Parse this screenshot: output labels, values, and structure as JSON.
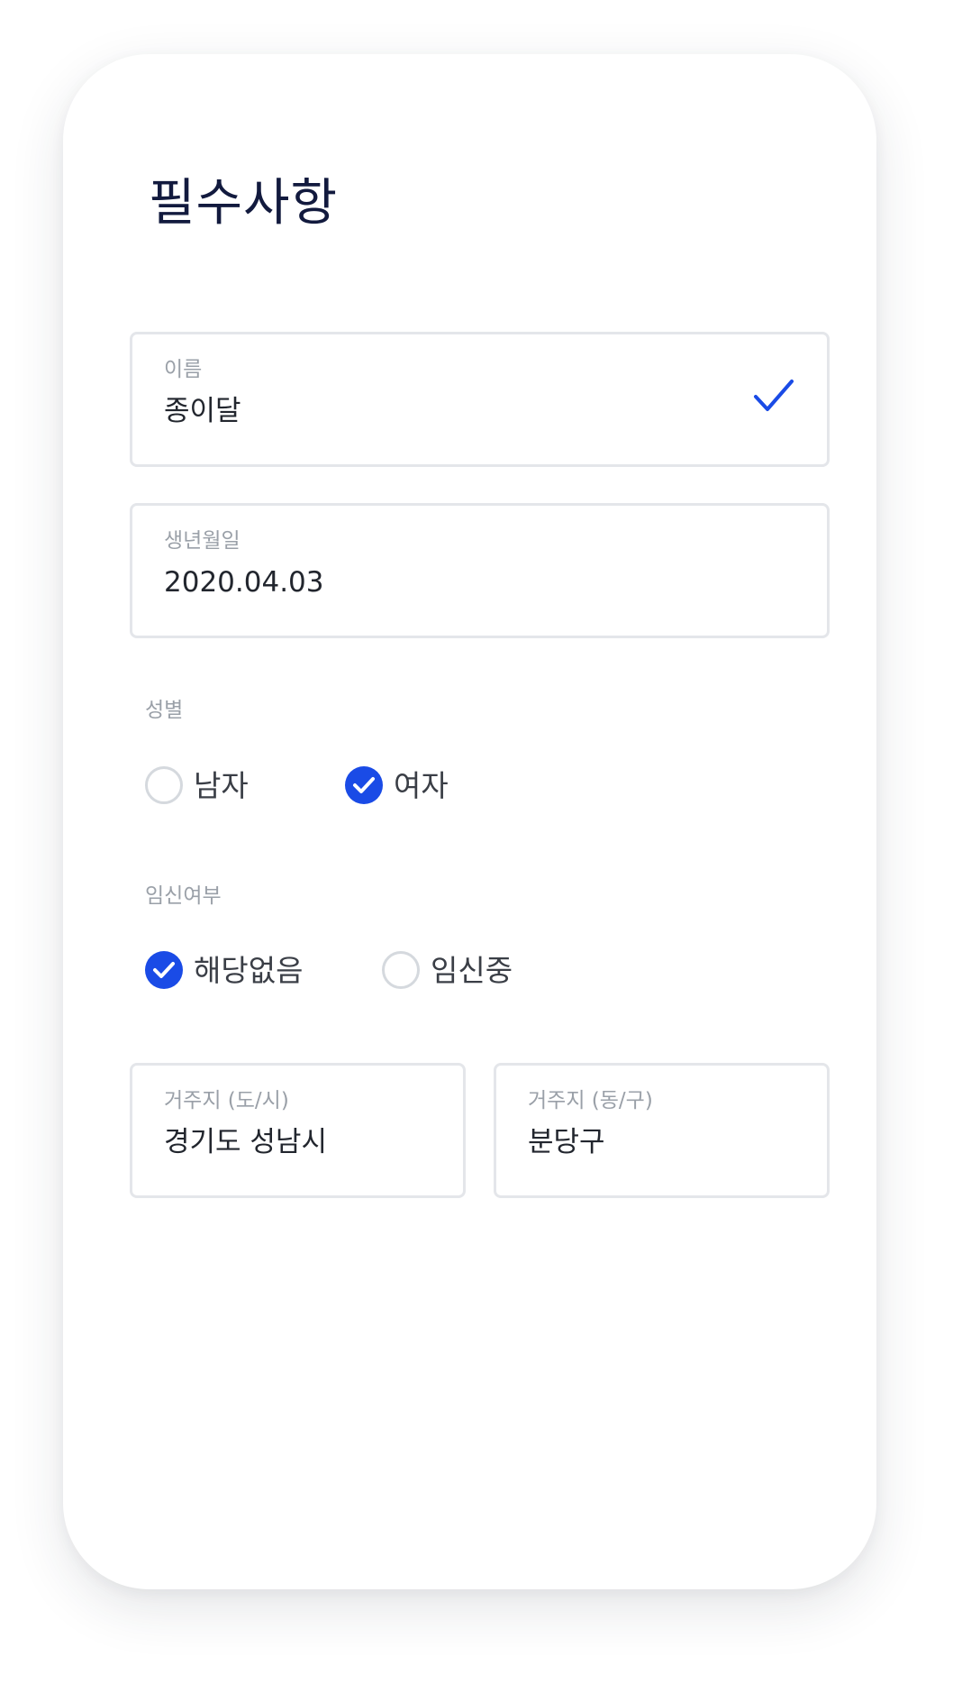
{
  "page": {
    "title": "필수사항"
  },
  "name_field": {
    "label": "이름",
    "value": "종이달",
    "validated": true,
    "icon": "check-icon"
  },
  "birth_field": {
    "label": "생년월일",
    "value": "2020.04.03"
  },
  "gender": {
    "label": "성별",
    "options": [
      {
        "label": "남자",
        "selected": false
      },
      {
        "label": "여자",
        "selected": true
      }
    ]
  },
  "pregnancy": {
    "label": "임신여부",
    "options": [
      {
        "label": "해당없음",
        "selected": true
      },
      {
        "label": "임신중",
        "selected": false
      }
    ]
  },
  "residence_city": {
    "label": "거주지 (도/시)",
    "value": "경기도 성남시"
  },
  "residence_district": {
    "label": "거주지 (동/구)",
    "value": "분당구"
  },
  "colors": {
    "accent": "#1a4be6",
    "title": "#121a3e",
    "border": "#e4e6ea",
    "label": "#9aa0a8",
    "value": "#22262e"
  }
}
